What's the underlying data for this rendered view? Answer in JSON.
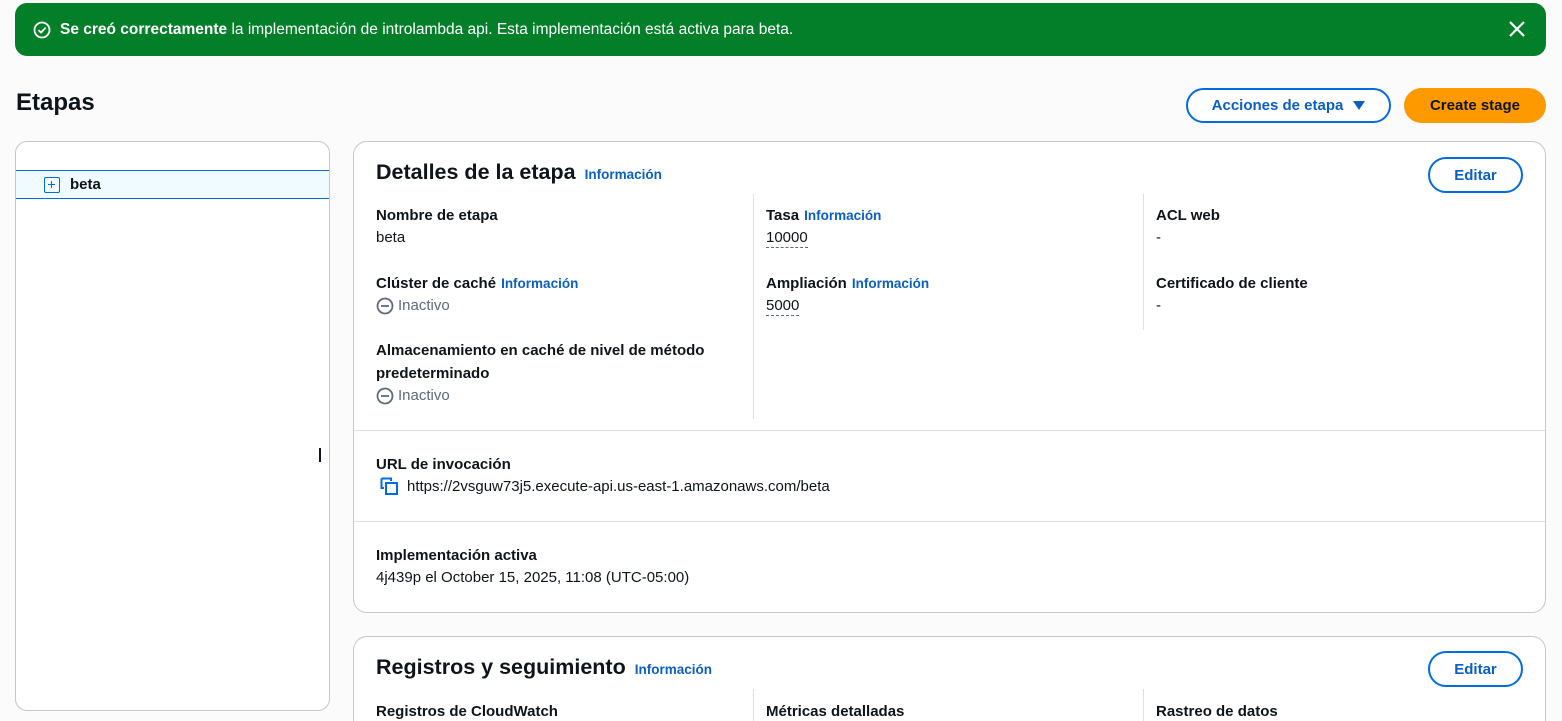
{
  "flash": {
    "bold": "Se creó correctamente",
    "text": " la implementación de introlambda api. Esta implementación está activa para beta."
  },
  "page": {
    "title": "Etapas",
    "stage_actions_label": "Acciones de etapa",
    "create_stage_label": "Create stage"
  },
  "tree": {
    "items": [
      {
        "label": "beta"
      }
    ]
  },
  "details": {
    "title": "Detalles de la etapa",
    "info": "Información",
    "edit": "Editar",
    "stage_name_label": "Nombre de etapa",
    "stage_name_value": "beta",
    "cache_cluster_label": "Clúster de caché",
    "cache_cluster_info": "Información",
    "cache_cluster_value": "Inactivo",
    "method_cache_label": "Almacenamiento en caché de nivel de método predeterminado",
    "method_cache_value": "Inactivo",
    "rate_label": "Tasa",
    "rate_info": "Información",
    "rate_value": "10000",
    "burst_label": "Ampliación",
    "burst_info": "Información",
    "burst_value": "5000",
    "waf_label": "ACL web",
    "waf_value": "-",
    "cert_label": "Certificado de cliente",
    "cert_value": "-",
    "invoke_url_label": "URL de invocación",
    "invoke_url_value": "https://2vsguw73j5.execute-api.us-east-1.amazonaws.com/beta",
    "active_deployment_label": "Implementación activa",
    "active_deployment_value": "4j439p el October 15, 2025, 11:08 (UTC-05:00)"
  },
  "logs": {
    "title": "Registros y seguimiento",
    "info": "Información",
    "edit": "Editar",
    "cloudwatch_label": "Registros de CloudWatch",
    "metrics_label": "Métricas detalladas",
    "tracing_label": "Rastreo de datos"
  },
  "colors": {
    "success": "#037f2a",
    "primary_button": "#ff9900",
    "link": "#0b5fc1"
  }
}
